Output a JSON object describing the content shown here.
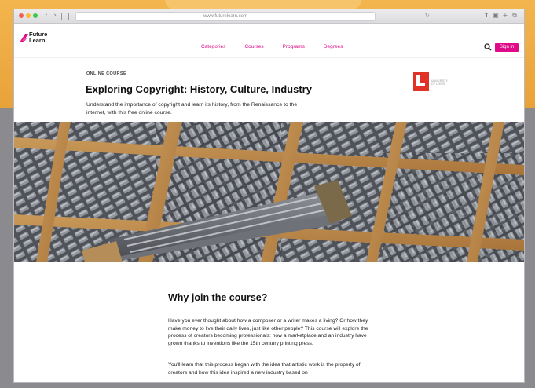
{
  "browser": {
    "url": "www.futurelearn.com",
    "back_glyph": "‹",
    "forward_glyph": "›",
    "reload_glyph": "↻",
    "icons": [
      "tab-icon",
      "share-icon",
      "tabs-icon",
      "add-tab-icon"
    ]
  },
  "site": {
    "logo_line1": "Future",
    "logo_line2": "Learn",
    "nav": [
      "Categories",
      "Courses",
      "Programs",
      "Degrees"
    ],
    "sign_in": "Sign in",
    "accent": "#de0a86"
  },
  "course": {
    "eyebrow": "ONLINE COURSE",
    "title": "Exploring Copyright: History, Culture, Industry",
    "subtitle": "Understand the importance of copyright and learn its history, from the Renaissance to the internet, with this free online course.",
    "partner_name": "UNIVERSITY OF LEEDS"
  },
  "why": {
    "heading": "Why join the course?",
    "paragraph1": "Have you ever thought about how a composer or a writer makes a living? Or how they make money to live their daily lives, just like other people? This course will explore the process of creators becoming professionals: how a marketplace and an industry have grown thanks to inventions like the 15th century printing press.",
    "paragraph2": "You'll learn that this process began with the idea that artistic work is the property of creators and how this idea inspired a new industry based on"
  }
}
